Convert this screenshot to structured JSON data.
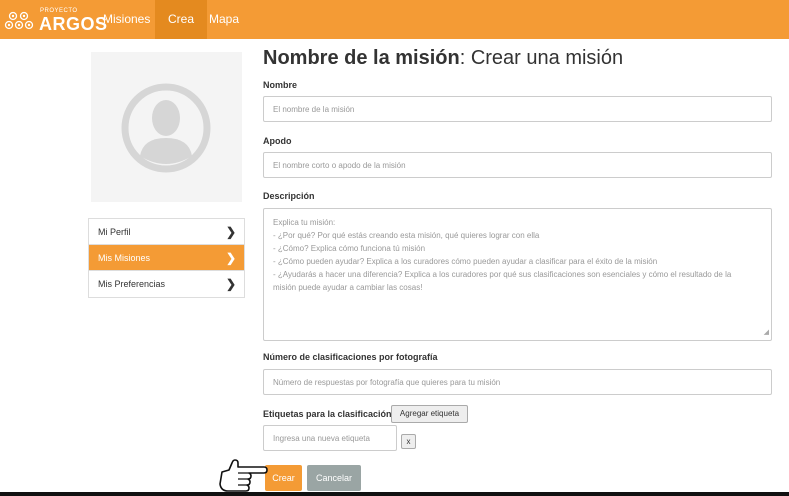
{
  "brand": {
    "small": "PROYECTO",
    "big": "ARGOS",
    "accent": "#f49b35"
  },
  "nav": {
    "items": [
      "Misiones",
      "Crea",
      "Mapa"
    ],
    "active": "Crea"
  },
  "sidebar": {
    "items": [
      {
        "label": "Mi Perfil",
        "active": false
      },
      {
        "label": "Mis Misiones",
        "active": true
      },
      {
        "label": "Mis Preferencias",
        "active": false
      }
    ]
  },
  "form": {
    "title_bold": "Nombre de la misión",
    "title_rest": ": Crear una misión",
    "name": {
      "label": "Nombre",
      "placeholder": "El nombre de la misión"
    },
    "nickname": {
      "label": "Apodo",
      "placeholder": "El nombre corto o apodo de la misión"
    },
    "description": {
      "label": "Descripción",
      "placeholder_lines": [
        "Explica tu misión:",
        "- ¿Por qué? Por qué estás creando esta misión, qué quieres lograr con ella",
        "- ¿Cómo? Explica cómo funciona tú misión",
        "- ¿Cómo pueden ayudar? Explica a los curadores cómo pueden ayudar a clasificar para el éxito de la misión",
        "- ¿Ayudarás a hacer una diferencia? Explica a los curadores por qué sus clasificaciones son esenciales y cómo el resultado de la",
        "misión puede ayudar a cambiar las cosas!"
      ]
    },
    "classifications": {
      "label": "Número de clasificaciones por fotografía",
      "placeholder": "Número de respuestas por fotografía que quieres para tu misión"
    },
    "tags": {
      "label": "Etiquetas para la clasificación",
      "add_button": "Agregar etiqueta",
      "placeholder": "Ingresa una nueva etiqueta",
      "remove_button": "x"
    },
    "submit": "Crear",
    "cancel": "Cancelar"
  },
  "icons": {
    "chevron": "chevron-right-icon",
    "pointer": "hand-pointer-icon",
    "avatar": "user-avatar-icon"
  }
}
